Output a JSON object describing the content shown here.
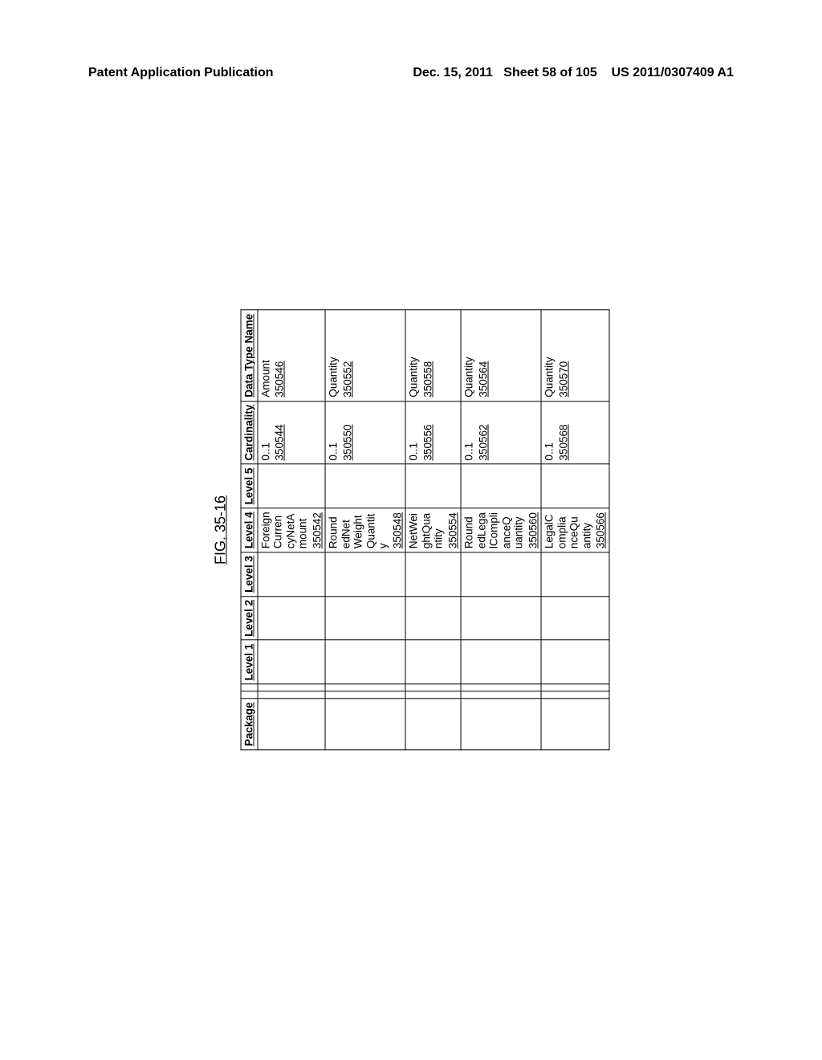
{
  "header": {
    "left": "Patent Application Publication",
    "date": "Dec. 15, 2011",
    "sheet": "Sheet 58 of 105",
    "pubno": "US 2011/0307409 A1"
  },
  "figure_label": "FIG. 35-16",
  "columns": {
    "package": "Package",
    "l1": "Level 1",
    "l2": "Level 2",
    "l3": "Level 3",
    "l4": "Level 4",
    "l5": "Level 5",
    "card": "Cardinality",
    "type": "Data Type Name"
  },
  "rows": [
    {
      "l4_name": "ForeignCurrencyNetAmount",
      "l4_ref": "350542",
      "card": "0..1",
      "card_ref": "350544",
      "type": "Amount",
      "type_ref": "350546"
    },
    {
      "l4_name": "RoundedNetWeightQuantity",
      "l4_ref": "350548",
      "card": "0..1",
      "card_ref": "350550",
      "type": "Quantity",
      "type_ref": "350552"
    },
    {
      "l4_name": "NetWeightQuantity",
      "l4_ref": "350554",
      "card": "0..1",
      "card_ref": "350556",
      "type": "Quantity",
      "type_ref": "350558"
    },
    {
      "l4_name": "RoundedLegalComplianceQuantity",
      "l4_ref": "350560",
      "card": "0..1",
      "card_ref": "350562",
      "type": "Quantity",
      "type_ref": "350564"
    },
    {
      "l4_name": "LegalComplianceQuantity",
      "l4_ref": "350566",
      "card": "0..1",
      "card_ref": "350568",
      "type": "Quantity",
      "type_ref": "350570"
    }
  ]
}
